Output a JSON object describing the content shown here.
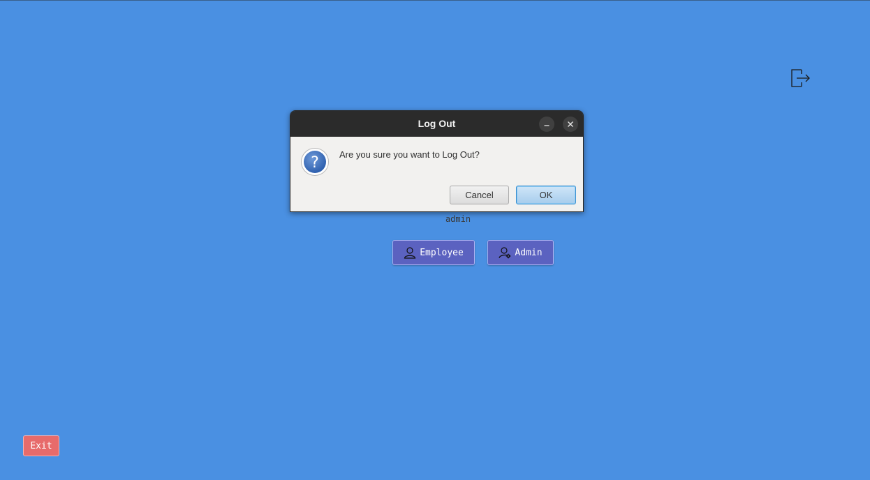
{
  "dialog": {
    "title": "Log Out",
    "message": "Are you sure you want to Log Out?",
    "cancel_label": "Cancel",
    "ok_label": "OK",
    "minimize_icon": "minimize-icon",
    "close_icon": "close-icon",
    "message_icon": "question-icon"
  },
  "main": {
    "username": "admin",
    "employee_label": "Employee",
    "admin_label": "Admin",
    "employee_icon": "user-icon",
    "admin_icon": "user-gear-icon",
    "logout_icon": "logout-icon",
    "exit_label": "Exit"
  },
  "colors": {
    "background": "#4a90e2",
    "role_button": "#5b62c0",
    "exit_button": "#e76b6b",
    "dialog_titlebar": "#2b2b2b",
    "dialog_body": "#f2f1ef",
    "ok_button": "#a7cdec"
  }
}
